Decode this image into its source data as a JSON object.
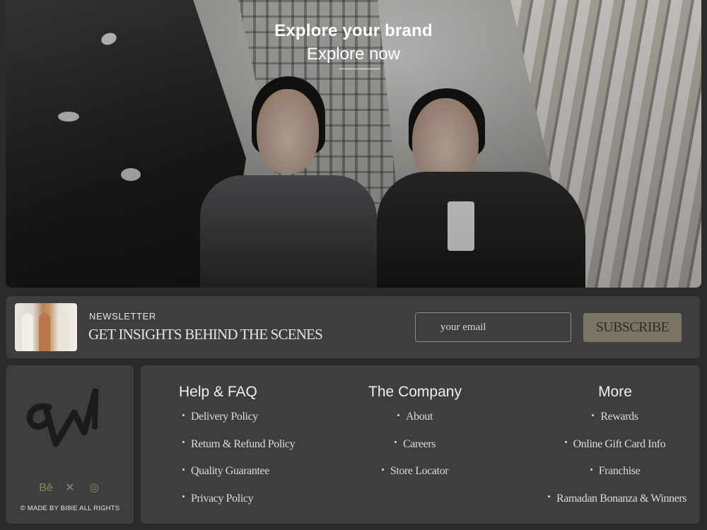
{
  "hero": {
    "title": "Explore your brand",
    "link_label": "Explore now"
  },
  "newsletter": {
    "label": "NEWSLETTER",
    "heading": "GET INSIGHTS BEHIND THE SCENES",
    "email_placeholder": "your email",
    "subscribe_label": "SUBSCRIBE"
  },
  "brand": {
    "socials": [
      {
        "icon": "behance-icon",
        "glyph": "Bē"
      },
      {
        "icon": "x-twitter-icon",
        "glyph": "✕"
      },
      {
        "icon": "instagram-icon",
        "glyph": "◎"
      }
    ],
    "copyright": "© MADE BY BI8IE ALL RIGHTS"
  },
  "footer": {
    "help": {
      "title": "Help & FAQ",
      "links": [
        "Delivery Policy",
        "Return & Refund Policy",
        "Quality Guarantee",
        "Privacy Policy"
      ]
    },
    "company": {
      "title": "The Company",
      "links": [
        "About",
        "Careers",
        "Store Locator"
      ]
    },
    "more": {
      "title": "More",
      "links": [
        "Rewards",
        "Online Gift Card Info",
        "Franchise",
        "Ramadan Bonanza & Winners"
      ]
    }
  },
  "colors": {
    "background": "#2c2b2b",
    "card": "#3f3e3e",
    "accent": "#7a7462",
    "social": "#8f8864"
  }
}
